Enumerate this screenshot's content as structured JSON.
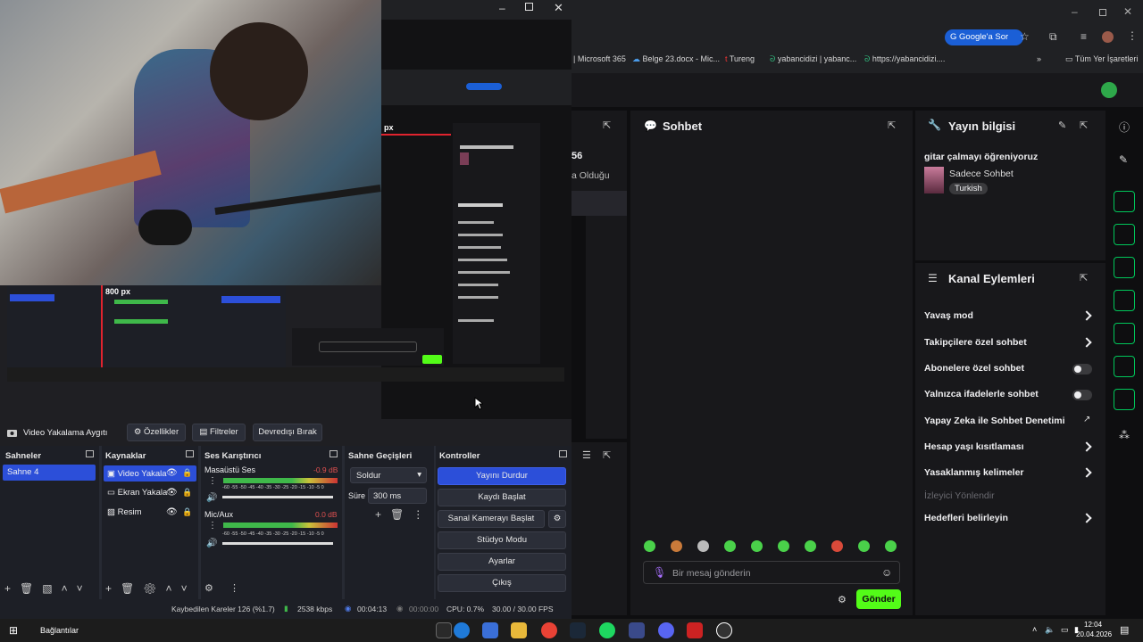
{
  "browser": {
    "search_chip": "Google'a Sor",
    "bookmarks": [
      "| Microsoft 365",
      "Belge 23.docx - Mic...",
      "Tureng",
      "yabancidizi | yabanc...",
      "https://yabancidizi...."
    ],
    "all_bookmarks": "Tüm Yer İşaretleri"
  },
  "twitch": {
    "partial_number": "56",
    "partial_text": "a Olduğu",
    "chat_title": "Sohbet",
    "stream_info_title": "Yayın bilgisi",
    "stream_title": "gitar çalmayı öğreniyoruz",
    "category": "Sadece Sohbet",
    "tag": "Turkish",
    "channel_actions_title": "Kanal Eylemleri",
    "actions": [
      {
        "label": "Yavaş mod",
        "kind": "chevron"
      },
      {
        "label": "Takipçilere özel sohbet",
        "kind": "chevron"
      },
      {
        "label": "Abonelere özel sohbet",
        "kind": "toggle"
      },
      {
        "label": "Yalnızca ifadelerle sohbet",
        "kind": "toggle"
      },
      {
        "label": "Yapay Zeka ile Sohbet Denetimi",
        "kind": "external"
      },
      {
        "label": "Hesap yaşı kısıtlaması",
        "kind": "chevron"
      },
      {
        "label": "Yasaklanmış kelimeler",
        "kind": "chevron"
      },
      {
        "label": "İzleyici Yönlendir",
        "kind": "disabled"
      },
      {
        "label": "Hedefleri belirleyin",
        "kind": "chevron"
      }
    ],
    "chat_placeholder": "Bir mesaj gönderin",
    "send_label": "Gönder",
    "accent": "#53fc18"
  },
  "obs": {
    "source_toolbar": {
      "device": "Video Yakalama Aygıtı",
      "properties": "Özellikler",
      "filters": "Filtreler",
      "deactivate": "Devredışı Bırak"
    },
    "scenes_title": "Sahneler",
    "scenes": [
      "Sahne 4"
    ],
    "sources_title": "Kaynaklar",
    "sources": [
      "Video Yakala",
      "Ekran Yakala",
      "Resim"
    ],
    "mixer_title": "Ses Karıştırıcı",
    "mixer": [
      {
        "name": "Masaüstü Ses",
        "db": "-0.9 dB"
      },
      {
        "name": "Mic/Aux",
        "db": "0.0 dB"
      }
    ],
    "meter_scale": "-60 -55 -50 -45 -40 -35 -30 -25 -20 -15 -10 -5 0",
    "transitions_title": "Sahne Geçişleri",
    "transition": "Soldur",
    "duration_label": "Süre",
    "duration": "300 ms",
    "controls_title": "Kontroller",
    "controls": [
      "Yayını Durdur",
      "Kaydı Başlat",
      "Sanal Kamerayı Başlat",
      "Stüdyo Modu",
      "Ayarlar",
      "Çıkış"
    ],
    "status": {
      "dropped": "Kaybedilen Kareler 126 (%1.7)",
      "bitrate": "2538 kbps",
      "stream_time": "00:04:13",
      "rec_time": "00:00:00",
      "cpu": "CPU: 0.7%",
      "fps": "30.00 / 30.00 FPS"
    },
    "preview_label": "800 px",
    "preview_label2": "px"
  },
  "taskbar": {
    "status": "Bağlantılar",
    "time": "12:04",
    "date": "20.04.2026"
  }
}
